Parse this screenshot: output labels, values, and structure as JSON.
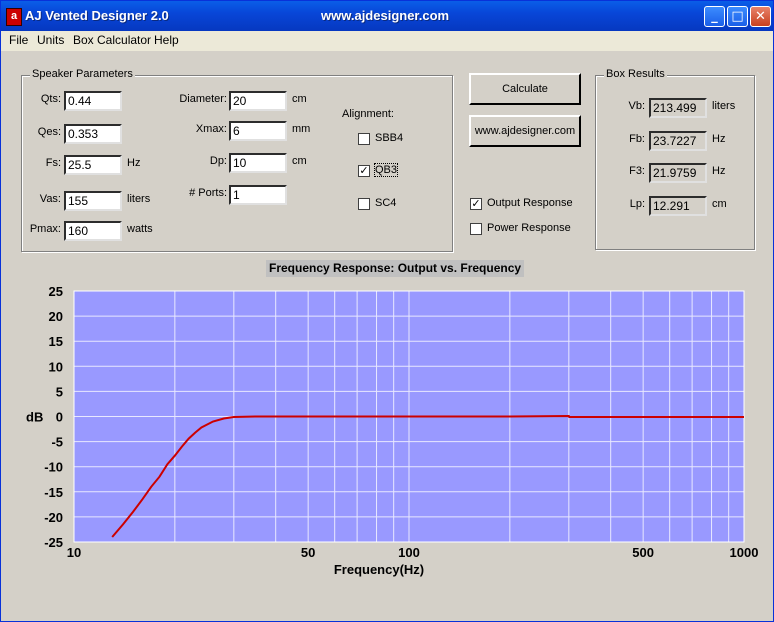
{
  "window": {
    "title": "AJ Vented Designer  2.0",
    "url": "www.ajdesigner.com",
    "icon_glyph": "a"
  },
  "menu": [
    "File",
    "Units",
    "Box Calculator",
    "Help"
  ],
  "speaker": {
    "group_label": "Speaker Parameters",
    "qts": {
      "label": "Qts:",
      "value": "0.44"
    },
    "qes": {
      "label": "Qes:",
      "value": "0.353"
    },
    "fs": {
      "label": "Fs:",
      "value": "25.5",
      "unit": "Hz"
    },
    "vas": {
      "label": "Vas:",
      "value": "155",
      "unit": "liters"
    },
    "pmax": {
      "label": "Pmax:",
      "value": "160",
      "unit": "watts"
    },
    "diameter": {
      "label": "Diameter:",
      "value": "20",
      "unit": "cm"
    },
    "xmax": {
      "label": "Xmax:",
      "value": "6",
      "unit": "mm"
    },
    "dp": {
      "label": "Dp:",
      "value": "10",
      "unit": "cm"
    },
    "ports": {
      "label": "# Ports:",
      "value": "1"
    }
  },
  "alignment": {
    "label": "Alignment:",
    "options": [
      {
        "label": "SBB4",
        "checked": false
      },
      {
        "label": "QB3",
        "checked": true
      },
      {
        "label": "SC4",
        "checked": false
      }
    ]
  },
  "buttons": {
    "calculate": "Calculate",
    "website": "www.ajdesigner.com"
  },
  "response": [
    {
      "label": "Output Response",
      "checked": true
    },
    {
      "label": "Power Response",
      "checked": false
    }
  ],
  "box_results": {
    "group_label": "Box Results",
    "vb": {
      "label": "Vb:",
      "value": "213.499",
      "unit": "liters"
    },
    "fb": {
      "label": "Fb:",
      "value": "23.7227",
      "unit": "Hz"
    },
    "f3": {
      "label": "F3:",
      "value": "21.9759",
      "unit": "Hz"
    },
    "lp": {
      "label": "Lp:",
      "value": "12.291",
      "unit": "cm"
    }
  },
  "colors": {
    "plot_bg": "#9999ff",
    "curve": "#cc0000",
    "grid": "#e8e8ff"
  },
  "chart_data": {
    "type": "line",
    "title": "Frequency Response: Output vs. Frequency",
    "xlabel": "Frequency(Hz)",
    "ylabel": "dB",
    "x_scale": "log",
    "xlim": [
      10,
      1000
    ],
    "ylim": [
      -25,
      25
    ],
    "x_tick_labels": [
      10,
      50,
      100,
      500,
      1000
    ],
    "y_ticks": [
      25,
      20,
      15,
      10,
      5,
      0,
      -5,
      -10,
      -15,
      -20,
      -25
    ],
    "grid": true,
    "series": [
      {
        "x": [
          13,
          14,
          15,
          16,
          17,
          18,
          19,
          20,
          21,
          22,
          23,
          24,
          26,
          28,
          30,
          35,
          40,
          60,
          100,
          200,
          300,
          301,
          500,
          1000
        ],
        "y": [
          -24,
          -21.5,
          -19,
          -16.5,
          -14,
          -12,
          -9.5,
          -7.8,
          -6.0,
          -4.4,
          -3.2,
          -2.2,
          -1.0,
          -0.4,
          -0.1,
          0,
          0,
          0,
          0,
          0,
          0.1,
          -0.1,
          -0.1,
          -0.1
        ]
      }
    ]
  }
}
